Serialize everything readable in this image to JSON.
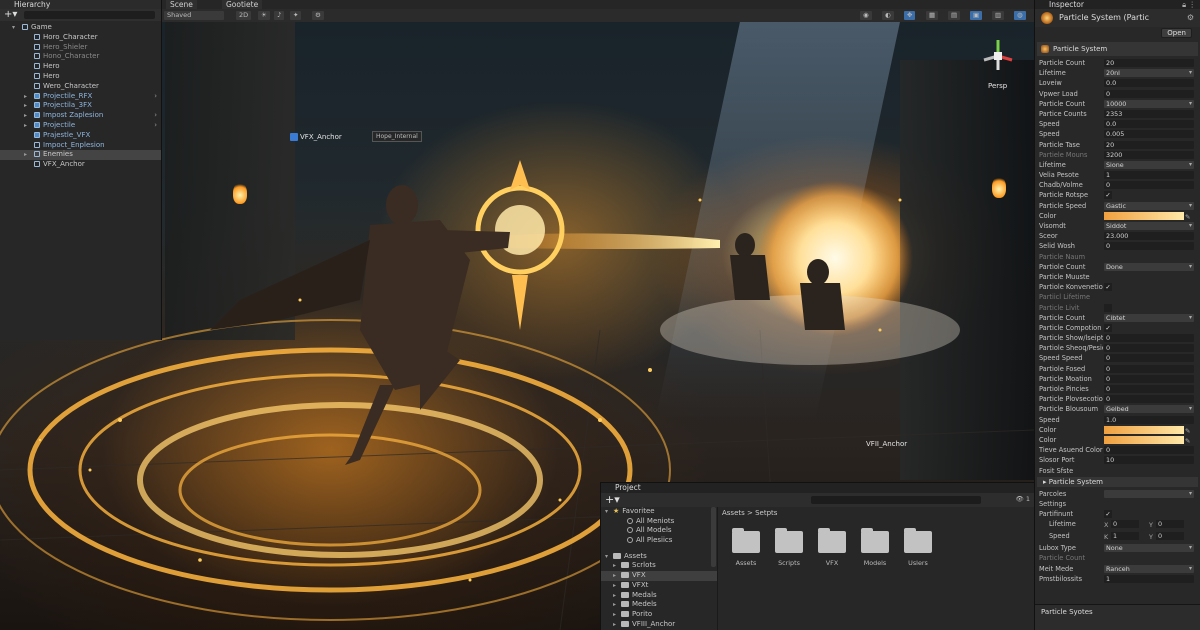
{
  "scene": {
    "tab_scene": "Scene",
    "tab_game": "Gootiete",
    "shading_mode": "Shaved",
    "toggle_2d": "2D",
    "persp_label": "Persp",
    "anchor_label_1": "VFX_Anchor",
    "anchor_label_2": "VFII_Anchor",
    "tag_label": "Hope_Internal"
  },
  "hierarchy": {
    "title": "Hierarchy",
    "items": [
      {
        "label": "Game",
        "selected": false
      },
      {
        "label": "Horo_Character"
      },
      {
        "label": "Hero_Shieler"
      },
      {
        "label": "Hono_Character"
      },
      {
        "label": "Hero"
      },
      {
        "label": "Hero"
      },
      {
        "label": "Wero_Character"
      },
      {
        "label": "Projectile_RFX"
      },
      {
        "label": "Projectila_3FX"
      },
      {
        "label": "Impost Zaplesion"
      },
      {
        "label": "Projectile"
      },
      {
        "label": "Prajestle_VFX"
      },
      {
        "label": "Impoct_Enplesion"
      },
      {
        "label": "Enemies",
        "selected": true
      },
      {
        "label": "VFX_Anchor"
      }
    ]
  },
  "inspector": {
    "title": "Inspector",
    "object_name": "Particle System (Partic",
    "open_label": "Open",
    "component_name": "Particle System",
    "rows": [
      {
        "label": "Particle Count",
        "value": "20",
        "kind": "field"
      },
      {
        "label": "Lifetime",
        "value": "20nl",
        "kind": "drop"
      },
      {
        "label": "Loveiw",
        "value": "0.0",
        "kind": "field"
      },
      {
        "label": "Vpwer Load",
        "value": "0",
        "kind": "field"
      },
      {
        "label": "Particle Count",
        "value": "10000",
        "kind": "drop"
      },
      {
        "label": "Partice Counts",
        "value": "2353",
        "kind": "field"
      },
      {
        "label": "Speed",
        "value": "0.0",
        "kind": "field"
      },
      {
        "label": "Speed",
        "value": "0.005",
        "kind": "field"
      },
      {
        "label": "Particle Tase",
        "value": "20",
        "kind": "field"
      },
      {
        "label": "Partiele Mouns",
        "value": "3200",
        "kind": "field",
        "dim": true
      },
      {
        "label": "Lifetime",
        "value": "Sione",
        "kind": "drop"
      },
      {
        "label": "Velia Pesote",
        "value": "1",
        "kind": "field"
      },
      {
        "label": "Chadb/Volme",
        "value": "0",
        "kind": "field"
      },
      {
        "label": "Particle Rotspe",
        "value": "✓",
        "kind": "check"
      },
      {
        "label": "Particle Speed",
        "value": "Gastic",
        "kind": "drop"
      },
      {
        "label": "Color",
        "value": "",
        "kind": "color"
      },
      {
        "label": "Visomdt",
        "value": "Siddot",
        "kind": "drop"
      },
      {
        "label": "Sceor",
        "value": "23.000",
        "kind": "field"
      },
      {
        "label": "Selid Wosh",
        "value": "0",
        "kind": "field"
      },
      {
        "label": "Particle Naum",
        "value": "",
        "kind": "none",
        "dim": true
      },
      {
        "label": "Partiole Count",
        "value": "Done",
        "kind": "drop"
      },
      {
        "label": "Particle Muuste",
        "value": "",
        "kind": "none"
      },
      {
        "label": "Partiole Konvenetion",
        "value": "✓",
        "kind": "check"
      },
      {
        "label": "Partiicl Lifetime",
        "value": "",
        "kind": "none",
        "dim": true
      },
      {
        "label": "Particle Livit",
        "value": "",
        "kind": "check",
        "dim": true
      },
      {
        "label": "Particle Count",
        "value": "Cibtet",
        "kind": "drop"
      },
      {
        "label": "Particle Compotion",
        "value": "✓",
        "kind": "check"
      },
      {
        "label": "Particle Show/lseipts",
        "value": "0",
        "kind": "field"
      },
      {
        "label": "Partiole Sheoq/Pesie",
        "value": "0",
        "kind": "field"
      },
      {
        "label": "Speed Speed",
        "value": "0",
        "kind": "field"
      },
      {
        "label": "Partiole Fosed",
        "value": "0",
        "kind": "field"
      },
      {
        "label": "Particle Moation",
        "value": "0",
        "kind": "field"
      },
      {
        "label": "Partiole Pincies",
        "value": "0",
        "kind": "field"
      },
      {
        "label": "Particle Plovsecotion",
        "value": "0",
        "kind": "field"
      },
      {
        "label": "Particle Blousoum",
        "value": "Gelbed",
        "kind": "drop"
      },
      {
        "label": "Speed",
        "value": "1.0",
        "kind": "field"
      },
      {
        "label": "Color",
        "value": "",
        "kind": "color"
      },
      {
        "label": "Color",
        "value": "",
        "kind": "color"
      },
      {
        "label": "Tieve Asuend Color",
        "value": "0",
        "kind": "field"
      },
      {
        "label": "Slosor Port",
        "value": "10",
        "kind": "field"
      },
      {
        "label": "Fosit Sfste",
        "value": "",
        "kind": "none"
      }
    ],
    "section2_name": "Particle System",
    "rows2": [
      {
        "label": "Parcoles",
        "value": "",
        "kind": "drop"
      },
      {
        "label": "Settings",
        "value": "",
        "kind": "none"
      },
      {
        "label": "Partifinunt",
        "value": "✓",
        "kind": "check"
      }
    ],
    "lifetime_label": "Lifetime",
    "lifetime_x": "0",
    "lifetime_y": "0",
    "speed_label": "Speed",
    "speed_x": "1",
    "speed_y": "0",
    "axis_x": "X",
    "axis_y": "Y",
    "axis_k": "K",
    "rows3": [
      {
        "label": "Lubox Type",
        "value": "None",
        "kind": "drop"
      },
      {
        "label": "Particle Count",
        "value": "",
        "kind": "none",
        "dim": true
      },
      {
        "label": "Meit Mede",
        "value": "Ranceh",
        "kind": "drop"
      },
      {
        "label": "Pmstbilossits",
        "value": "1",
        "kind": "field"
      }
    ],
    "footer_name": "Particle Syotes"
  },
  "project": {
    "title": "Project",
    "count": "1",
    "tree": [
      {
        "label": "Favoritee",
        "kind": "fav"
      },
      {
        "label": "All Meniots",
        "kind": "search"
      },
      {
        "label": "All Models",
        "kind": "search"
      },
      {
        "label": "All Plesiics",
        "kind": "search"
      },
      {
        "label": "",
        "kind": "gap"
      },
      {
        "label": "Assets",
        "kind": "folder"
      },
      {
        "label": "Scrlots",
        "kind": "folder"
      },
      {
        "label": "VFX",
        "kind": "folder",
        "selected": true
      },
      {
        "label": "VFXt",
        "kind": "folder"
      },
      {
        "label": "Medals",
        "kind": "folder"
      },
      {
        "label": "Medels",
        "kind": "folder"
      },
      {
        "label": "Porito",
        "kind": "folder"
      },
      {
        "label": "VFIII_Anchor",
        "kind": "folder"
      }
    ],
    "breadcrumb": "Assets > Setpts",
    "folders": [
      "Assets",
      "Scripts",
      "VFX",
      "Models",
      "Uslers"
    ]
  }
}
